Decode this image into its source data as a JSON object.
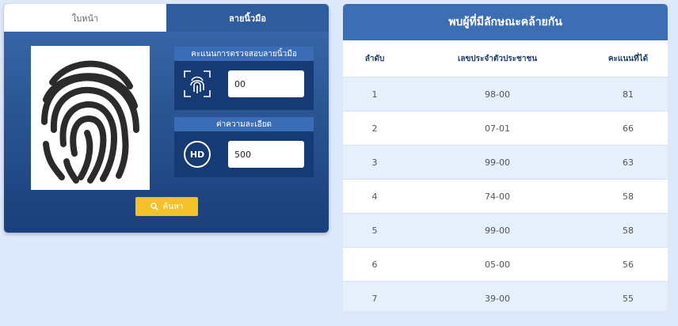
{
  "tabs": {
    "home": "ใบหน้า",
    "fingerprint": "ลายนิ้วมือ"
  },
  "score_card": {
    "header": "คะแนนการตรวจสอบลายนิ้วมือ",
    "value": "00"
  },
  "resolution_card": {
    "header": "ค่าความละเอียด",
    "icon_text": "HD",
    "value": "500"
  },
  "search_button": {
    "label": "ค้นหา"
  },
  "results": {
    "title": "พบผู้ที่มีลักษณะคล้ายกัน",
    "columns": {
      "rank": "ลำดับ",
      "id": "เลขประจำตัวประชาชน",
      "score": "คะแนนที่ได้"
    },
    "rows": [
      {
        "rank": "1",
        "id": "98-00",
        "score": "81"
      },
      {
        "rank": "2",
        "id": "07-01",
        "score": "66"
      },
      {
        "rank": "3",
        "id": "99-00",
        "score": "63"
      },
      {
        "rank": "4",
        "id": "74-00",
        "score": "58"
      },
      {
        "rank": "5",
        "id": "99-00",
        "score": "58"
      },
      {
        "rank": "6",
        "id": "05-00",
        "score": "56"
      },
      {
        "rank": "7",
        "id": "39-00",
        "score": "55"
      }
    ]
  }
}
